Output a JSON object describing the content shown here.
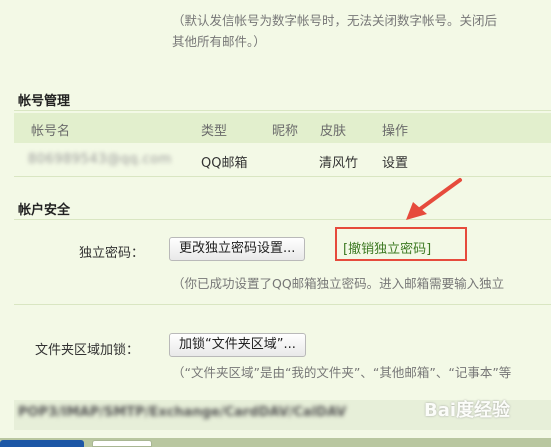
{
  "top_note": {
    "line1": "（默认发信帐号为数字帐号时，无法关闭数字帐号。关闭后",
    "line2": "其他所有邮件。）"
  },
  "account_management": {
    "title": "帐号管理",
    "columns": [
      "帐号名",
      "类型",
      "昵称",
      "皮肤",
      "操作"
    ],
    "rows": [
      {
        "account": "806989543@qq.com",
        "type": "QQ邮箱",
        "nickname": "",
        "skin": "清风竹",
        "action": "设置"
      }
    ]
  },
  "account_security": {
    "title": "帐户安全",
    "password_label": "独立密码：",
    "change_button": "更改独立密码设置...",
    "revoke_link": "[撤销独立密码]",
    "password_hint": "（你已成功设置了QQ邮箱独立密码。进入邮箱需要输入独立",
    "folder_lock_label": "文件夹区域加锁：",
    "folder_lock_button": "加锁“文件夹区域”...",
    "folder_hint": "（“文件夹区域”是由“我的文件夹”、“其他邮箱”、“记事本”等"
  },
  "bottom_section": {
    "text": "POP3/IMAP/SMTP/Exchange/CardDAV/CalDAV"
  },
  "watermark": {
    "text": "Bai度经验"
  },
  "colors": {
    "page_bg": "#f3f9e6",
    "header_band": "#e2efcd",
    "highlight": "#e64b3c",
    "link": "#3e7a23"
  }
}
